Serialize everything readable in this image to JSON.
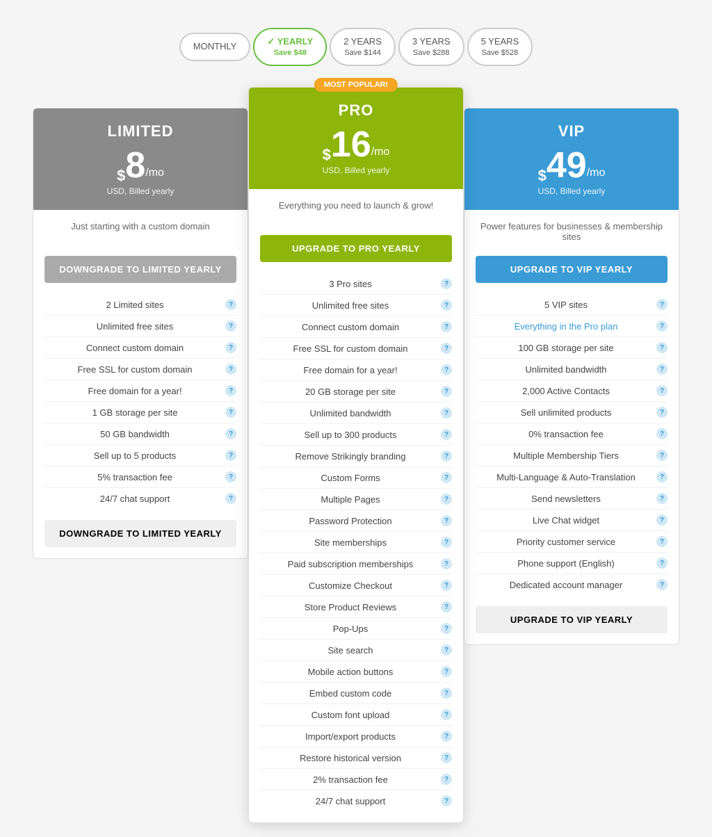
{
  "billing": {
    "options": [
      {
        "id": "monthly",
        "label": "MONTHLY",
        "save": null,
        "active": false
      },
      {
        "id": "yearly",
        "label": "YEARLY",
        "save": "Save $48",
        "active": true
      },
      {
        "id": "2years",
        "label": "2 YEARS",
        "save": "Save $144",
        "active": false
      },
      {
        "id": "3years",
        "label": "3 YEARS",
        "save": "Save $288",
        "active": false
      },
      {
        "id": "5years",
        "label": "5 YEARS",
        "save": "Save $528",
        "active": false
      }
    ]
  },
  "plans": {
    "limited": {
      "name": "LIMITED",
      "price_symbol": "$",
      "price": "8",
      "price_period": "/mo",
      "billing_note": "USD, Billed yearly",
      "description": "Just starting with a custom domain",
      "cta_top": "DOWNGRADE TO LIMITED YEARLY",
      "cta_bottom": "DOWNGRADE TO LIMITED YEARLY",
      "features": [
        "2 Limited sites",
        "Unlimited free sites",
        "Connect custom domain",
        "Free SSL for custom domain",
        "Free domain for a year!",
        "1 GB storage per site",
        "50 GB bandwidth",
        "Sell up to 5 products",
        "5% transaction fee",
        "24/7 chat support"
      ]
    },
    "pro": {
      "name": "PRO",
      "badge": "MOST POPULAR!",
      "price_symbol": "$",
      "price": "16",
      "price_period": "/mo",
      "billing_note": "USD, Billed yearly",
      "description": "Everything you need to launch & grow!",
      "cta_top": "UPGRADE TO PRO YEARLY",
      "features": [
        "3 Pro sites",
        "Unlimited free sites",
        "Connect custom domain",
        "Free SSL for custom domain",
        "Free domain for a year!",
        "20 GB storage per site",
        "Unlimited bandwidth",
        "Sell up to 300 products",
        "Remove Strikingly branding",
        "Custom Forms",
        "Multiple Pages",
        "Password Protection",
        "Site memberships",
        "Paid subscription memberships",
        "Customize Checkout",
        "Store Product Reviews",
        "Pop-Ups",
        "Site search",
        "Mobile action buttons",
        "Embed custom code",
        "Custom font upload",
        "Import/export products",
        "Restore historical version",
        "2% transaction fee",
        "24/7 chat support"
      ]
    },
    "vip": {
      "name": "VIP",
      "price_symbol": "$",
      "price": "49",
      "price_period": "/mo",
      "billing_note": "USD, Billed yearly",
      "description": "Power features for businesses & membership sites",
      "cta_top": "UPGRADE TO VIP YEARLY",
      "cta_bottom": "UPGRADE TO VIP YEARLY",
      "features": [
        "5 VIP sites",
        "Everything in the Pro plan",
        "100 GB storage per site",
        "Unlimited bandwidth",
        "2,000 Active Contacts",
        "Sell unlimited products",
        "0% transaction fee",
        "Multiple Membership Tiers",
        "Multi-Language & Auto-Translation",
        "Send newsletters",
        "Live Chat widget",
        "Priority customer service",
        "Phone support (English)",
        "Dedicated account manager"
      ],
      "highlight_feature": "Everything in the Pro plan"
    }
  },
  "icons": {
    "check": "✓",
    "question": "?"
  }
}
